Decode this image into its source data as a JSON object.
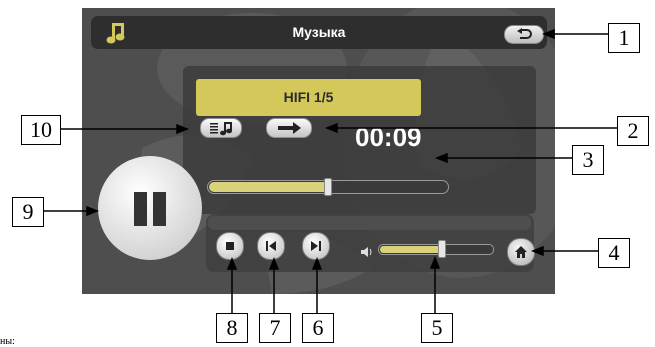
{
  "window": {
    "title": "Музыка",
    "back_icon": "return-arrow-icon",
    "note_icon": "music-note-icon"
  },
  "player": {
    "track_label": "HIFI 1/5",
    "elapsed_time": "00:09",
    "progress_fraction": 0.5,
    "volume_fraction": 0.55,
    "playlist_icon": "playlist-icon",
    "mode_icon": "arrow-right-icon",
    "pause_icon": "pause-icon",
    "stop_icon": "stop-icon",
    "prev_icon": "previous-track-icon",
    "next_icon": "next-track-icon",
    "volume_icon": "speaker-icon",
    "home_icon": "home-icon"
  },
  "colors": {
    "accent": "#d4c85a",
    "screen_bg": "#4e4e4e",
    "title_bar": "#2e2e2e"
  },
  "callouts": [
    "1",
    "2",
    "3",
    "4",
    "5",
    "6",
    "7",
    "8",
    "9",
    "10"
  ],
  "corner_text": "ны:"
}
